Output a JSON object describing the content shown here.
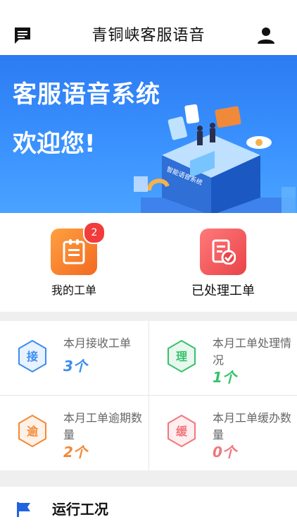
{
  "header": {
    "title": "青铜峡客服语音",
    "left_icon": "message-icon",
    "right_icon": "user-icon"
  },
  "banner": {
    "line1": "客服语音系统",
    "line2": "欢迎您!",
    "sign_text": "智能语音系统"
  },
  "quick_actions": [
    {
      "label": "我的工单",
      "badge": "2",
      "icon": "clipboard-icon",
      "color": "#f7772a"
    },
    {
      "label": "已处理工单",
      "icon": "document-check-icon",
      "color": "#ef4a4f"
    }
  ],
  "stats": [
    {
      "glyph": "接",
      "label": "本月接收工单",
      "value": "3个",
      "color": "#3b8df0"
    },
    {
      "glyph": "理",
      "label": "本月工单处理情况",
      "value": "1个",
      "color": "#36c26b"
    },
    {
      "glyph": "逾",
      "label": "本月工单逾期数量",
      "value": "2个",
      "color": "#f08a3a"
    },
    {
      "glyph": "缓",
      "label": "本月工单缓办数量",
      "value": "0个",
      "color": "#f0777c"
    }
  ],
  "section": {
    "label": "运行工况",
    "icon": "flag-icon"
  }
}
